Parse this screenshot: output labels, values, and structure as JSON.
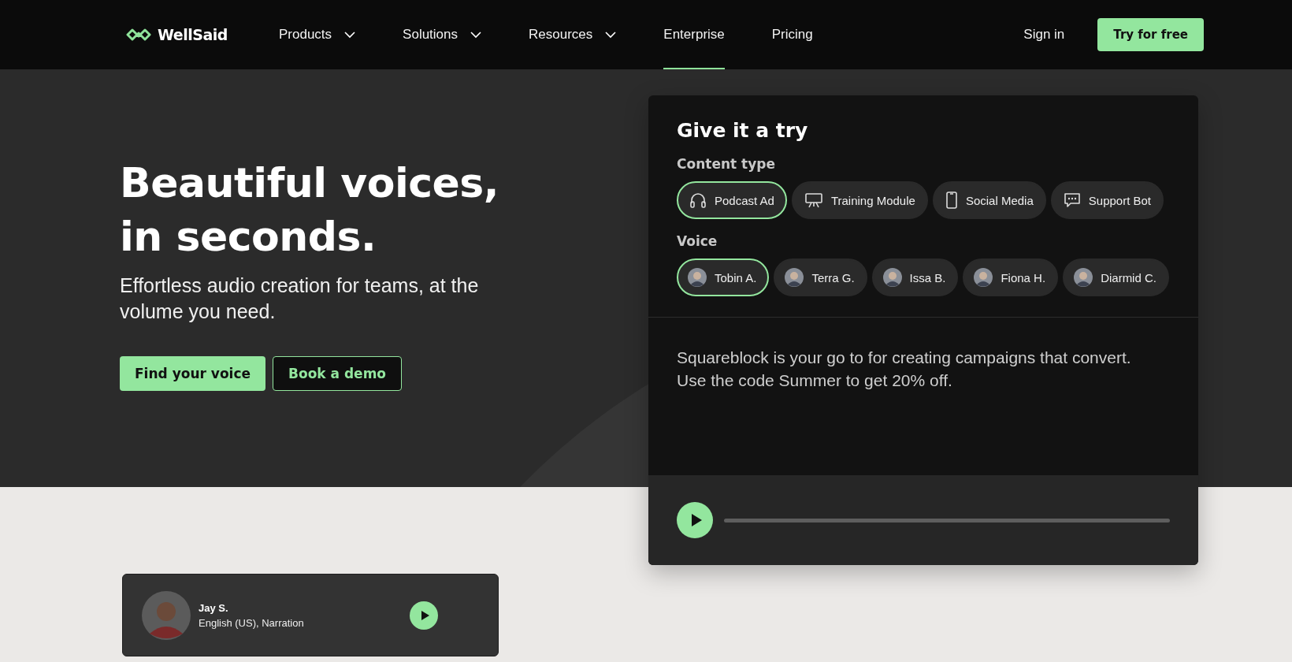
{
  "nav": {
    "logo": "WellSaid",
    "items": [
      {
        "label": "Products",
        "dropdown": true,
        "selected": false
      },
      {
        "label": "Solutions",
        "dropdown": true,
        "selected": false
      },
      {
        "label": "Resources",
        "dropdown": true,
        "selected": false
      },
      {
        "label": "Enterprise",
        "dropdown": false,
        "selected": true
      },
      {
        "label": "Pricing",
        "dropdown": false,
        "selected": false
      }
    ],
    "sign_in": "Sign in",
    "cta": "Try for free"
  },
  "hero": {
    "title_lines": [
      "Beautiful voices,",
      "in seconds."
    ],
    "subtitle": "Effortless audio creation for teams, at the volume you need.",
    "primary_button": "Find your voice",
    "secondary_button": "Book a demo"
  },
  "try_card": {
    "title": "Give it a try",
    "content_type_label": "Content type",
    "content_types": [
      {
        "label": "Podcast Ad",
        "kind": "headphones",
        "selected": true
      },
      {
        "label": "Training Module",
        "kind": "easel",
        "selected": false
      },
      {
        "label": "Social Media",
        "kind": "phone",
        "selected": false
      },
      {
        "label": "Support Bot",
        "kind": "chat",
        "selected": false
      }
    ],
    "voice_label": "Voice",
    "voices": [
      {
        "name": "Tobin A.",
        "selected": true
      },
      {
        "name": "Terra G.",
        "selected": false
      },
      {
        "name": "Issa B.",
        "selected": false
      },
      {
        "name": "Fiona H.",
        "selected": false
      },
      {
        "name": "Diarmid C.",
        "selected": false
      }
    ],
    "script": "Squareblock is your go to for creating campaigns that convert. Use the code Summer to get 20% off.",
    "player": {
      "level": 0
    }
  },
  "voice_card": {
    "name": "Jay S.",
    "details": "English (US), Narration"
  }
}
